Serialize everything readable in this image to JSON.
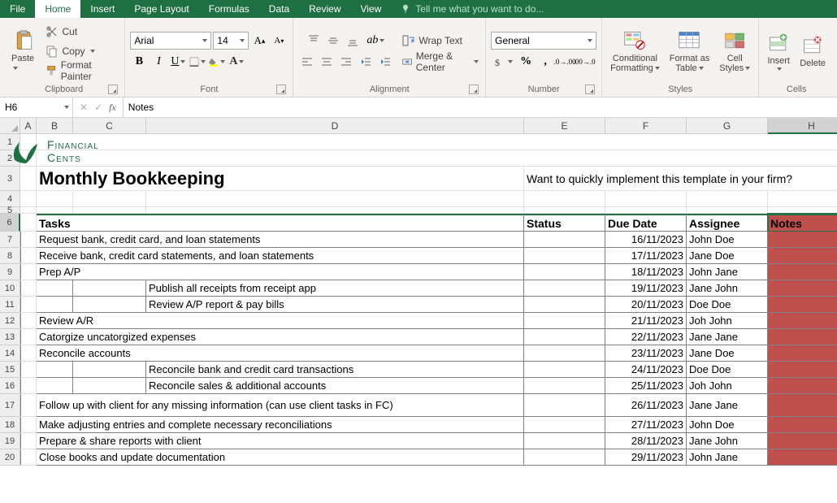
{
  "tabs": {
    "file": "File",
    "home": "Home",
    "insert": "Insert",
    "page_layout": "Page Layout",
    "formulas": "Formulas",
    "data": "Data",
    "review": "Review",
    "view": "View"
  },
  "tell_me": "Tell me what you want to do...",
  "ribbon": {
    "clipboard": {
      "paste": "Paste",
      "cut": "Cut",
      "copy": "Copy",
      "format_painter": "Format Painter",
      "label": "Clipboard"
    },
    "font": {
      "name": "Arial",
      "size": "14",
      "label": "Font"
    },
    "alignment": {
      "wrap": "Wrap Text",
      "merge": "Merge & Center",
      "label": "Alignment"
    },
    "number": {
      "format": "General",
      "label": "Number"
    },
    "styles": {
      "cond": "Conditional\nFormatting",
      "table": "Format as\nTable",
      "cell": "Cell\nStyles",
      "label": "Styles"
    },
    "cells": {
      "insert": "Insert",
      "delete": "Delete",
      "label": "Cells"
    }
  },
  "namebox": "H6",
  "formula": "Notes",
  "columns": [
    "A",
    "B",
    "C",
    "D",
    "E",
    "F",
    "G",
    "H"
  ],
  "logo": {
    "l1": "Financial",
    "l2": "Cents"
  },
  "doc_title": "Monthly Bookkeeping",
  "prompt_text": "Want to quickly implement this template in your firm?",
  "headers": {
    "tasks": "Tasks",
    "status": "Status",
    "due": "Due Date",
    "assignee": "Assignee",
    "notes": "Notes"
  },
  "rows": [
    {
      "indent": 0,
      "task": "Request bank, credit card, and loan statements",
      "due": "16/11/2023",
      "assignee": "John Doe"
    },
    {
      "indent": 0,
      "task": "Receive bank, credit card statements, and loan statements",
      "due": "17/11/2023",
      "assignee": "Jane Doe"
    },
    {
      "indent": 0,
      "task": "Prep A/P",
      "due": "18/11/2023",
      "assignee": "John Jane"
    },
    {
      "indent": 1,
      "task": "Publish all receipts from receipt app",
      "due": "19/11/2023",
      "assignee": "Jane John"
    },
    {
      "indent": 1,
      "task": "Review A/P report & pay bills",
      "due": "20/11/2023",
      "assignee": "Doe Doe"
    },
    {
      "indent": 0,
      "task": "Review A/R",
      "due": "21/11/2023",
      "assignee": "Joh John"
    },
    {
      "indent": 0,
      "task": "Catorgize uncatorgized expenses",
      "due": "22/11/2023",
      "assignee": "Jane Jane"
    },
    {
      "indent": 0,
      "task": "Reconcile accounts",
      "due": "23/11/2023",
      "assignee": "Jane Doe"
    },
    {
      "indent": 1,
      "task": "Reconcile bank and credit card transactions",
      "due": "24/11/2023",
      "assignee": "Doe Doe"
    },
    {
      "indent": 1,
      "task": "Reconcile sales & additional accounts",
      "due": "25/11/2023",
      "assignee": "Joh John"
    },
    {
      "indent": 0,
      "task": "Follow up with client for any missing information (can use client tasks in FC)",
      "due": "26/11/2023",
      "assignee": "Jane Jane",
      "tall": true
    },
    {
      "indent": 0,
      "task": "Make adjusting entries and complete necessary reconciliations",
      "due": "27/11/2023",
      "assignee": "John Doe"
    },
    {
      "indent": 0,
      "task": "Prepare & share reports with client",
      "due": "28/11/2023",
      "assignee": "Jane John"
    },
    {
      "indent": 0,
      "task": "Close books and update documentation",
      "due": "29/11/2023",
      "assignee": "John Jane"
    }
  ]
}
